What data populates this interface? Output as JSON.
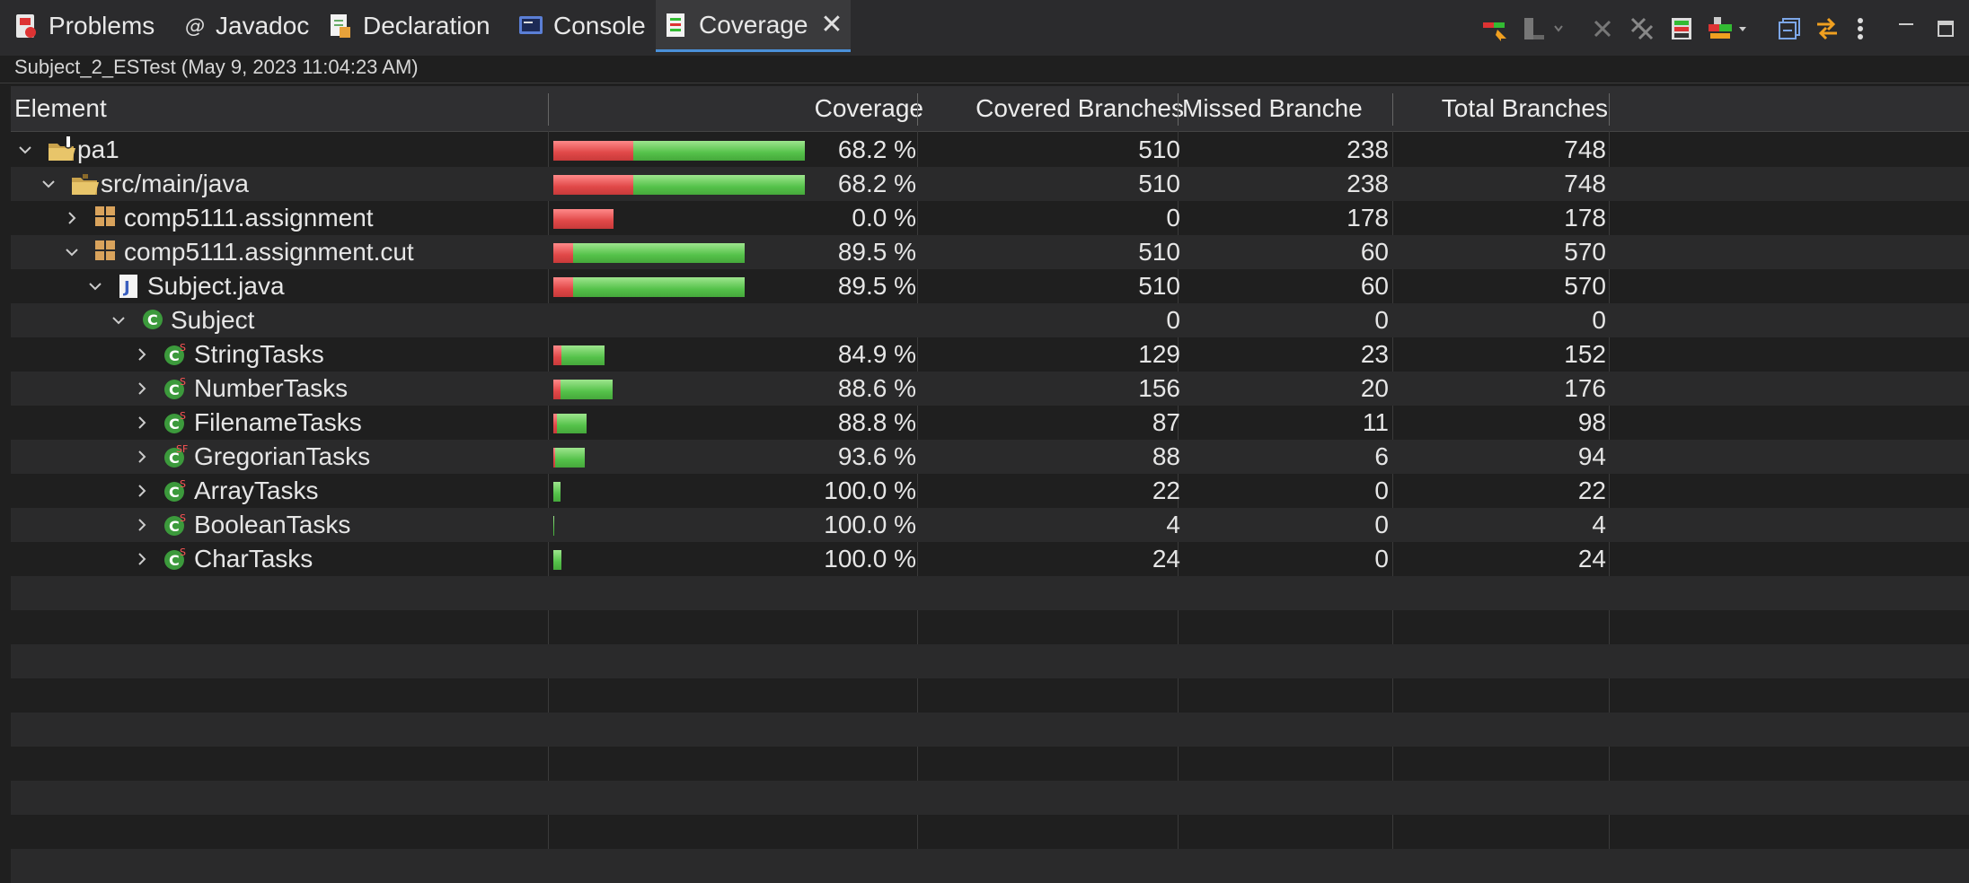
{
  "tabs": [
    {
      "label": "Problems",
      "icon": "problems-icon"
    },
    {
      "label": "Javadoc",
      "icon": "javadoc-icon"
    },
    {
      "label": "Declaration",
      "icon": "declaration-icon"
    },
    {
      "label": "Console",
      "icon": "console-icon"
    },
    {
      "label": "Coverage",
      "icon": "coverage-icon",
      "active": true
    }
  ],
  "toolbar_icons": [
    "relaunch-icon",
    "remove-session-icon",
    "remove-active-session-icon",
    "remove-all-sessions-icon",
    "merge-sessions-icon",
    "select-counters-icon",
    "collapse-all-icon",
    "link-with-editor-icon",
    "view-menu-icon",
    "minimize-icon",
    "maximize-icon"
  ],
  "session": "Subject_2_ESTest (May 9, 2023 11:04:23 AM)",
  "columns": {
    "element": "Element",
    "coverage": "Coverage",
    "covered": "Covered Branches",
    "missed": "Missed Branche",
    "total": "Total Branches"
  },
  "rows": [
    {
      "name": "pa1",
      "depth": 0,
      "expanded": true,
      "icon": "project-icon",
      "coverage": "68.2 %",
      "pct": 68.2,
      "covered": "510",
      "missed": "238",
      "total": "748"
    },
    {
      "name": "src/main/java",
      "depth": 1,
      "expanded": true,
      "icon": "source-folder-icon",
      "coverage": "68.2 %",
      "pct": 68.2,
      "covered": "510",
      "missed": "238",
      "total": "748"
    },
    {
      "name": "comp5111.assignment",
      "depth": 2,
      "expanded": false,
      "icon": "package-icon",
      "coverage": "0.0 %",
      "pct": 0.0,
      "covered": "0",
      "missed": "178",
      "total": "178"
    },
    {
      "name": "comp5111.assignment.cut",
      "depth": 2,
      "expanded": true,
      "icon": "package-icon",
      "coverage": "89.5 %",
      "pct": 89.5,
      "covered": "510",
      "missed": "60",
      "total": "570"
    },
    {
      "name": "Subject.java",
      "depth": 3,
      "expanded": true,
      "icon": "java-file-icon",
      "coverage": "89.5 %",
      "pct": 89.5,
      "covered": "510",
      "missed": "60",
      "total": "570"
    },
    {
      "name": "Subject",
      "depth": 4,
      "expanded": true,
      "icon": "class-icon",
      "coverage": "",
      "pct": null,
      "covered": "0",
      "missed": "0",
      "total": "0"
    },
    {
      "name": "StringTasks",
      "depth": 5,
      "expanded": false,
      "icon": "static-class-icon",
      "coverage": "84.9 %",
      "pct": 84.9,
      "covered": "129",
      "missed": "23",
      "total": "152"
    },
    {
      "name": "NumberTasks",
      "depth": 5,
      "expanded": false,
      "icon": "static-class-icon",
      "coverage": "88.6 %",
      "pct": 88.6,
      "covered": "156",
      "missed": "20",
      "total": "176"
    },
    {
      "name": "FilenameTasks",
      "depth": 5,
      "expanded": false,
      "icon": "static-class-icon",
      "coverage": "88.8 %",
      "pct": 88.8,
      "covered": "87",
      "missed": "11",
      "total": "98"
    },
    {
      "name": "GregorianTasks",
      "depth": 5,
      "expanded": false,
      "icon": "static-final-class-icon",
      "coverage": "93.6 %",
      "pct": 93.6,
      "covered": "88",
      "missed": "6",
      "total": "94"
    },
    {
      "name": "ArrayTasks",
      "depth": 5,
      "expanded": false,
      "icon": "static-class-icon",
      "coverage": "100.0 %",
      "pct": 100.0,
      "covered": "22",
      "missed": "0",
      "total": "22"
    },
    {
      "name": "BooleanTasks",
      "depth": 5,
      "expanded": false,
      "icon": "static-class-icon",
      "coverage": "100.0 %",
      "pct": 100.0,
      "covered": "4",
      "missed": "0",
      "total": "4"
    },
    {
      "name": "CharTasks",
      "depth": 5,
      "expanded": false,
      "icon": "static-class-icon",
      "coverage": "100.0 %",
      "pct": 100.0,
      "covered": "24",
      "missed": "0",
      "total": "24"
    }
  ],
  "colors": {
    "covered": "#55c24a",
    "missed": "#e04848",
    "accent": "#4a90d9"
  }
}
